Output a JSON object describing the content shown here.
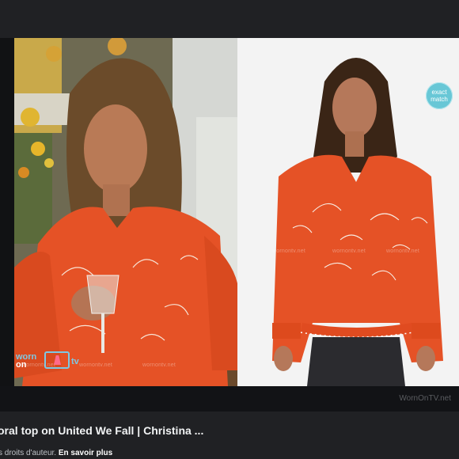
{
  "overlays": {
    "match_badge": "exact match",
    "watermark_text": "wornontv.net"
  },
  "brand": {
    "logo_worn": "worn",
    "logo_on": "on",
    "logo_tv": "tv",
    "site_mark": "WornOnTV.net"
  },
  "caption": {
    "title": "oral top on United We Fall | Christina ...",
    "license_text": "s droits d'auteur.",
    "learn_more": "En savoir plus"
  },
  "colors": {
    "blouse": "#e55226",
    "badge": "#68c7d6",
    "page_bg": "#202124"
  },
  "icons": [
    "tv-icon",
    "dress-icon"
  ]
}
